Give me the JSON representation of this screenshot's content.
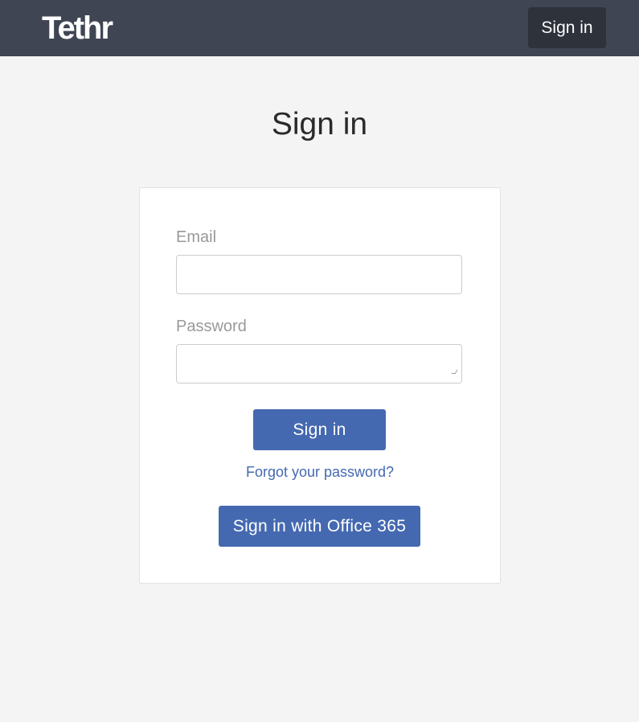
{
  "header": {
    "logo_text": "Tethr",
    "signin_label": "Sign in"
  },
  "page": {
    "title": "Sign in"
  },
  "form": {
    "email_label": "Email",
    "email_value": "",
    "password_label": "Password",
    "password_value": "",
    "submit_label": "Sign in",
    "forgot_label": "Forgot your password?",
    "office365_label": "Sign in with Office 365"
  },
  "colors": {
    "header_bg": "#3f4553",
    "header_button_bg": "#2d323b",
    "page_bg": "#f4f4f4",
    "primary": "#4569b0",
    "label_gray": "#999999"
  }
}
